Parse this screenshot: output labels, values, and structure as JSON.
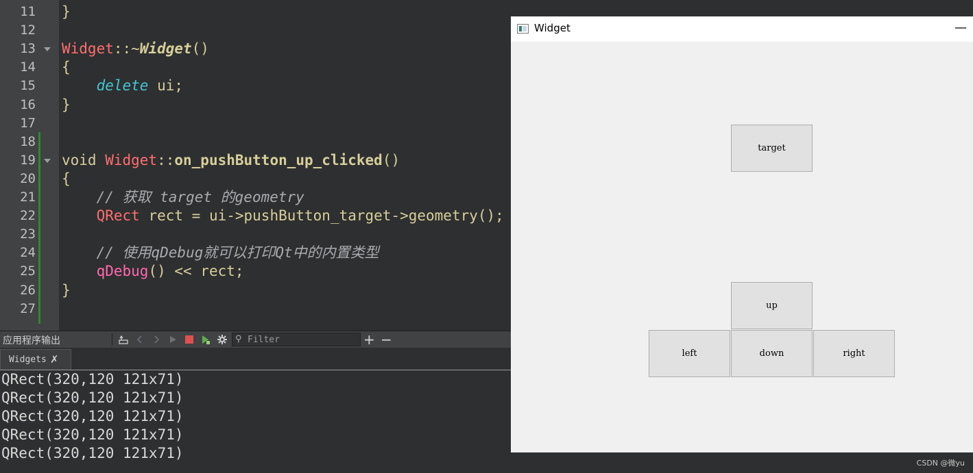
{
  "editor": {
    "lines": [
      {
        "n": "11",
        "fold": false,
        "tokens": [
          {
            "c": "plain",
            "t": "}"
          }
        ]
      },
      {
        "n": "12",
        "fold": false,
        "tokens": []
      },
      {
        "n": "13",
        "fold": true,
        "tokens": [
          {
            "c": "type",
            "t": "Widget"
          },
          {
            "c": "plain",
            "t": "::~"
          },
          {
            "c": "fnit",
            "t": "Widget"
          },
          {
            "c": "plain",
            "t": "()"
          }
        ]
      },
      {
        "n": "14",
        "fold": false,
        "tokens": [
          {
            "c": "plain",
            "t": "{"
          }
        ]
      },
      {
        "n": "15",
        "fold": false,
        "tokens": [
          {
            "c": "plain",
            "t": "    "
          },
          {
            "c": "kw",
            "t": "delete"
          },
          {
            "c": "plain",
            "t": " ui;"
          }
        ]
      },
      {
        "n": "16",
        "fold": false,
        "tokens": [
          {
            "c": "plain",
            "t": "}"
          }
        ]
      },
      {
        "n": "17",
        "fold": false,
        "tokens": []
      },
      {
        "n": "18",
        "fold": false,
        "tokens": []
      },
      {
        "n": "19",
        "fold": true,
        "tokens": [
          {
            "c": "plain",
            "t": "void "
          },
          {
            "c": "type",
            "t": "Widget"
          },
          {
            "c": "plain",
            "t": "::"
          },
          {
            "c": "fn",
            "t": "on_pushButton_up_clicked"
          },
          {
            "c": "plain",
            "t": "()"
          }
        ]
      },
      {
        "n": "20",
        "fold": false,
        "tokens": [
          {
            "c": "plain",
            "t": "{"
          }
        ]
      },
      {
        "n": "21",
        "fold": false,
        "tokens": [
          {
            "c": "plain",
            "t": "    "
          },
          {
            "c": "cmt",
            "t": "// 获取 target 的geometry"
          }
        ]
      },
      {
        "n": "22",
        "fold": false,
        "tokens": [
          {
            "c": "plain",
            "t": "    "
          },
          {
            "c": "type",
            "t": "QRect"
          },
          {
            "c": "plain",
            "t": " rect = ui->pushButton_target->geometry();"
          }
        ]
      },
      {
        "n": "23",
        "fold": false,
        "tokens": []
      },
      {
        "n": "24",
        "fold": false,
        "tokens": [
          {
            "c": "plain",
            "t": "    "
          },
          {
            "c": "cmt",
            "t": "// 使用qDebug就可以打印Qt中的内置类型"
          }
        ]
      },
      {
        "n": "25",
        "fold": false,
        "tokens": [
          {
            "c": "plain",
            "t": "    "
          },
          {
            "c": "call",
            "t": "qDebug"
          },
          {
            "c": "plain",
            "t": "() << rect;"
          }
        ]
      },
      {
        "n": "26",
        "fold": false,
        "tokens": [
          {
            "c": "plain",
            "t": "}"
          }
        ]
      },
      {
        "n": "27",
        "fold": false,
        "tokens": []
      }
    ]
  },
  "output_pane": {
    "title": "应用程序输出",
    "filter_placeholder": "Filter",
    "plus": "+",
    "minus": "−",
    "tab_label": "Widgets",
    "tab_close": "✗",
    "log": [
      "QRect(320,120 121x71)",
      "QRect(320,120 121x71)",
      "QRect(320,120 121x71)",
      "QRect(320,120 121x71)",
      "QRect(320,120 121x71)"
    ]
  },
  "widget_window": {
    "title": "Widget",
    "minimize": "—",
    "buttons": {
      "target": "target",
      "up": "up",
      "left": "left",
      "down": "down",
      "right": "right"
    }
  },
  "watermark": "CSDN @微yu",
  "colors": {
    "editor_bg": "#2e2f30",
    "gutter_bg": "#404244",
    "type_red": "#ff6f6f",
    "keyword_cyan": "#45c6d6",
    "call_pink": "#ff6ab0",
    "default_yellow": "#d6cf9a",
    "stop_red": "#e05050",
    "run_green": "#5fae4a"
  }
}
